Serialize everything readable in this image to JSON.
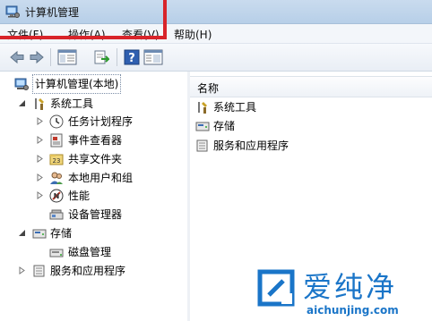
{
  "window": {
    "title": "计算机管理"
  },
  "menu": {
    "file": "文件(F)",
    "action": "操作(A)",
    "view": "查看(V)",
    "help": "帮助(H)"
  },
  "toolbar": {
    "buttons": [
      "back-arrow-icon",
      "forward-arrow-icon",
      "show-hide-tree-icon",
      "export-list-icon",
      "help-icon",
      "properties-icon"
    ]
  },
  "tree": {
    "root": "计算机管理(本地)",
    "system_tools": "系统工具",
    "task_scheduler": "任务计划程序",
    "event_viewer": "事件查看器",
    "shared_folders": "共享文件夹",
    "local_users": "本地用户和组",
    "performance": "性能",
    "device_manager": "设备管理器",
    "storage": "存储",
    "disk_management": "磁盘管理",
    "services_apps": "服务和应用程序"
  },
  "list": {
    "column_name": "名称",
    "items": [
      "系统工具",
      "存储",
      "服务和应用程序"
    ]
  },
  "watermark": {
    "text": "爱纯净",
    "url": "aichunjing.com"
  },
  "colors": {
    "highlight_box": "#d8242a",
    "watermark": "#1a75c8"
  }
}
